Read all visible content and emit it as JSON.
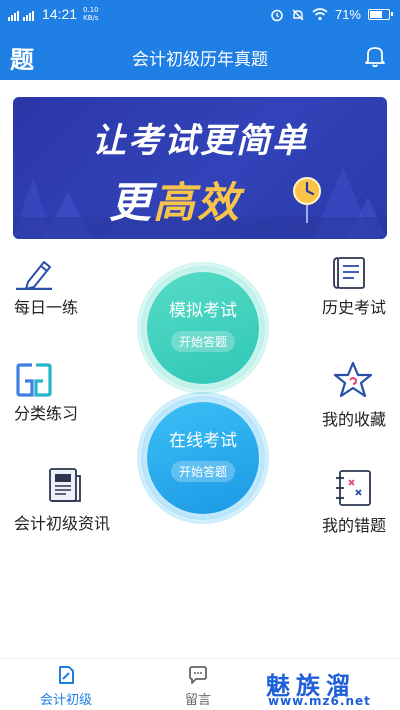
{
  "status_bar": {
    "sim1": "4G HD",
    "sim2": "4G HD",
    "time": "14:21",
    "speed_value": "0.10",
    "speed_unit": "KB/s",
    "battery": "71%",
    "battery_level": 0.71,
    "icons": [
      "alarm-icon",
      "mute-icon",
      "wifi-icon",
      "battery-icon"
    ]
  },
  "header": {
    "logo": "题",
    "title": "会计初级历年真题",
    "right_icon": "bell-icon"
  },
  "banner": {
    "line1": "让考试更简单",
    "line2_prefix": "更",
    "line2_highlight": "高效"
  },
  "tiles": {
    "daily": "每日一练",
    "category": "分类练习",
    "news": "会计初级资讯",
    "history": "历史考试",
    "favorites": "我的收藏",
    "mistakes": "我的错题"
  },
  "circles": {
    "mock": {
      "title": "模拟考试",
      "button": "开始答题"
    },
    "online": {
      "title": "在线考试",
      "button": "开始答题"
    }
  },
  "tabbar": {
    "tab1": "会计初级",
    "tab2": "留言"
  },
  "watermark": {
    "brand": "魅族溜",
    "url": "www.mz6.net"
  },
  "colors": {
    "primary": "#1f7fe5",
    "banner_bg": "#2f3fb4",
    "banner_highlight": "#f8c54a",
    "mock_circle": "#3ed3c0",
    "online_circle": "#1fb0f0"
  }
}
